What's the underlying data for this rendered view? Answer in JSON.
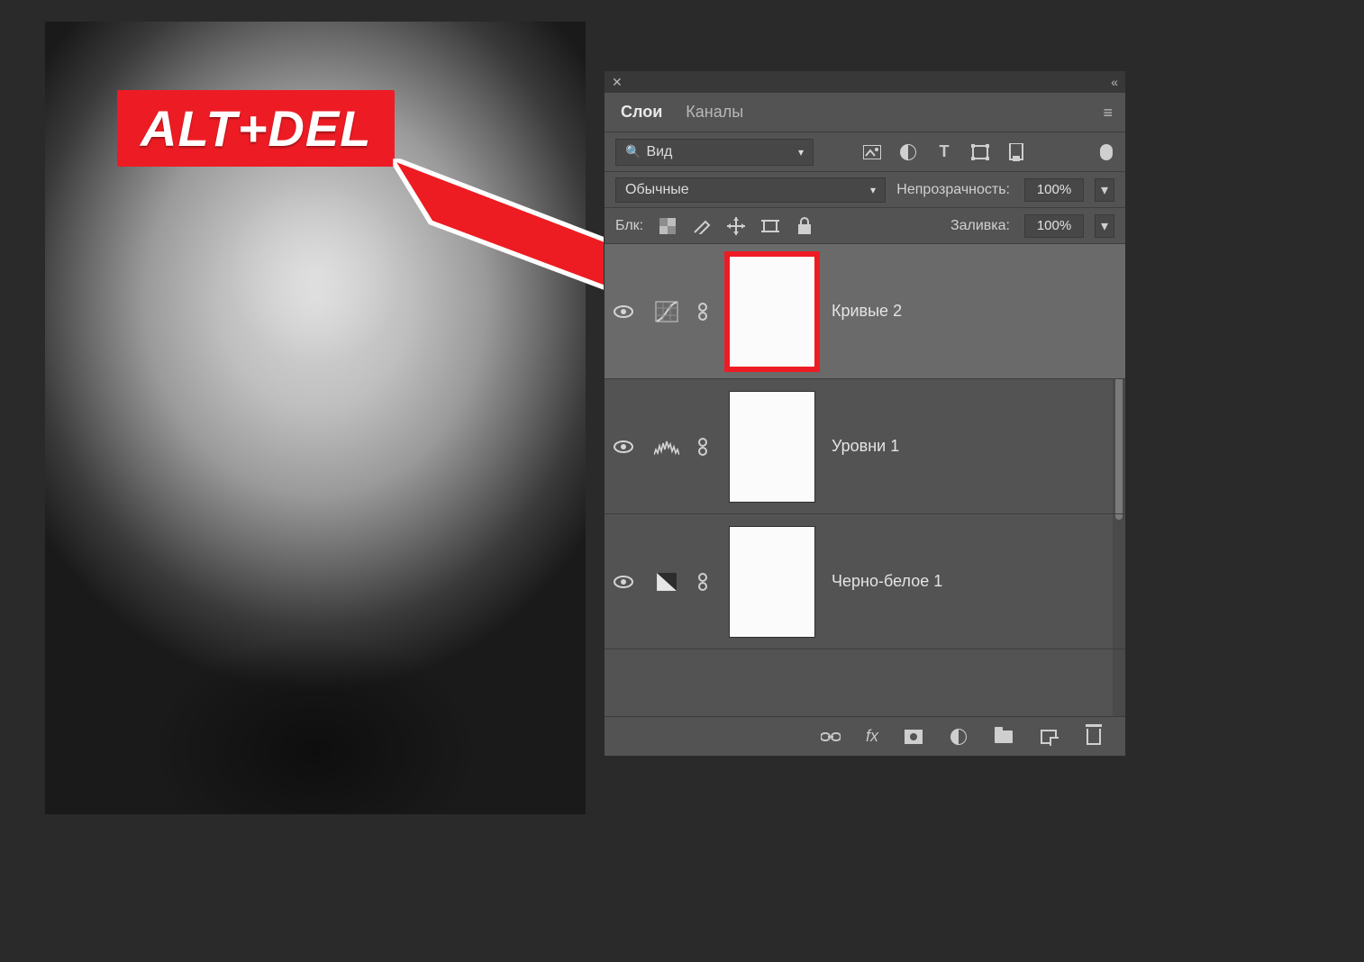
{
  "annotation": {
    "shortcut_text": "ALT+DEL",
    "highlight_color": "#ed1c24"
  },
  "panel": {
    "tabs": {
      "layers": "Слои",
      "channels": "Каналы"
    },
    "filter": {
      "kind_label": "Вид",
      "icons": {
        "pixel": "image-icon",
        "adjust": "adjust-icon",
        "text": "T",
        "shape": "shape-icon",
        "smart": "smart-icon"
      }
    },
    "blend": {
      "mode": "Обычные",
      "opacity_label": "Непрозрачность:",
      "opacity_value": "100%"
    },
    "lock": {
      "label": "Блк:",
      "fill_label": "Заливка:",
      "fill_value": "100%"
    },
    "layers": [
      {
        "name": "Кривые 2",
        "type": "curves",
        "selected": true,
        "mask_highlighted": true
      },
      {
        "name": "Уровни 1",
        "type": "levels",
        "selected": false,
        "mask_highlighted": false
      },
      {
        "name": "Черно-белое 1",
        "type": "bw",
        "selected": false,
        "mask_highlighted": false
      }
    ],
    "bottom_icons": {
      "link": "link-icon",
      "fx": "fx",
      "mask": "add-mask-icon",
      "adjust": "adjustment-icon",
      "group": "group-icon",
      "new": "new-layer-icon",
      "delete": "delete-icon"
    }
  }
}
